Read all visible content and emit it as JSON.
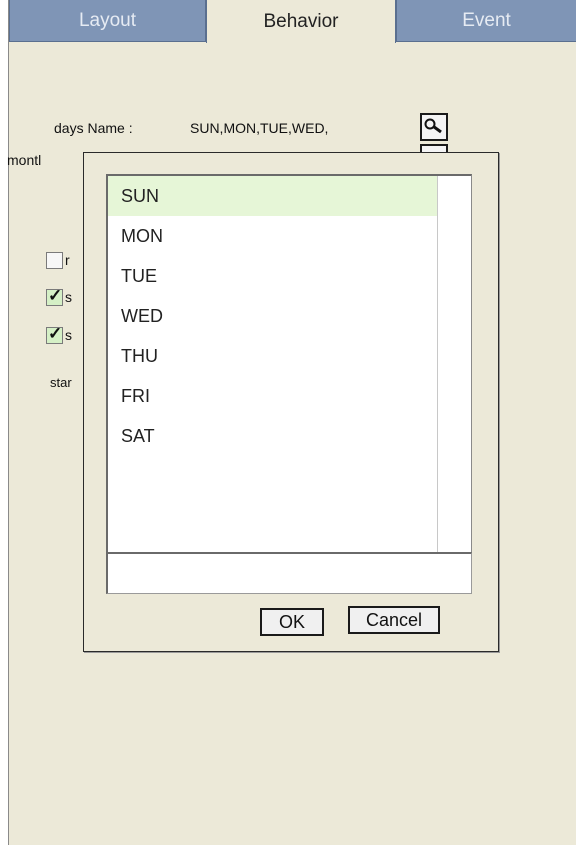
{
  "tabs": [
    {
      "label": "Layout",
      "active": false
    },
    {
      "label": "Behavior",
      "active": true
    },
    {
      "label": "Event",
      "active": false
    }
  ],
  "behavior": {
    "days_name_label": "days Name :",
    "days_name_value": "SUN,MON,TUE,WED,",
    "month_label_partial": "montl",
    "checkbox_letters": [
      "r",
      "s",
      "s"
    ],
    "start_label_partial": "star",
    "checkbox_states": [
      false,
      true,
      true
    ]
  },
  "dialog": {
    "items": [
      "SUN",
      "MON",
      "TUE",
      "WED",
      "THU",
      "FRI",
      "SAT"
    ],
    "selected": "SUN",
    "input_value": "",
    "ok_label": "OK",
    "cancel_label": "Cancel"
  },
  "colors": {
    "panel_bg": "#ece9d8",
    "tab_inactive": "#7f95b6",
    "selected_row": "#e6f6d7"
  },
  "icons": {
    "find_button": "magnifier-icon"
  }
}
